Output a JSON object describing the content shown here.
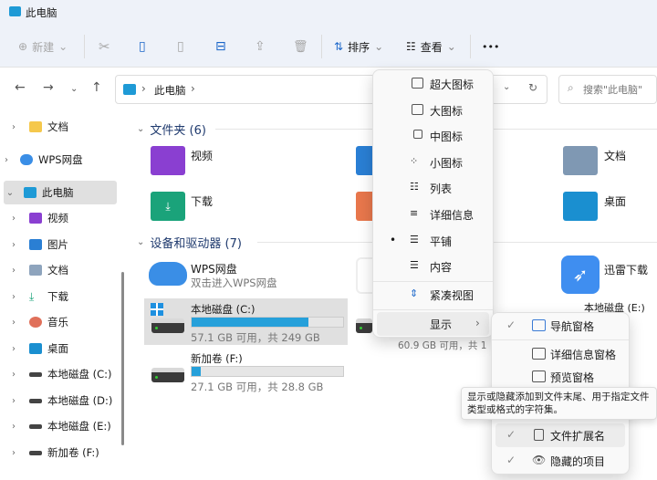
{
  "window": {
    "title": "此电脑"
  },
  "toolbar": {
    "new": "新建",
    "sort": "排序",
    "view": "查看",
    "more": "•••"
  },
  "address": {
    "path": "此电脑",
    "search_placeholder": "搜索\"此电脑\""
  },
  "sidebar": [
    {
      "label": "文档"
    },
    {
      "label": "WPS网盘"
    },
    {
      "label": "此电脑"
    },
    {
      "label": "视频"
    },
    {
      "label": "图片"
    },
    {
      "label": "文档"
    },
    {
      "label": "下载"
    },
    {
      "label": "音乐"
    },
    {
      "label": "桌面"
    },
    {
      "label": "本地磁盘 (C:)"
    },
    {
      "label": "本地磁盘 (D:)"
    },
    {
      "label": "本地磁盘 (E:)"
    },
    {
      "label": "新加卷 (F:)"
    }
  ],
  "folders": {
    "header": "文件夹 (6)",
    "items": [
      {
        "name": "视频"
      },
      {
        "name": "文档"
      },
      {
        "name": "下载"
      },
      {
        "name": "桌面"
      }
    ]
  },
  "devices": {
    "header": "设备和驱动器 (7)",
    "wps": {
      "name": "WPS网盘",
      "sub": "双击进入WPS网盘"
    },
    "xunlei": {
      "name": "迅雷下载"
    },
    "drives": [
      {
        "name": "本地磁盘 (C:)",
        "info": "57.1 GB 可用，共 249 GB",
        "used_fraction": 0.77
      },
      {
        "name": "新加卷 (F:)",
        "info": "27.1 GB 可用，共 28.8 GB",
        "used_fraction": 0.06
      },
      {
        "name": "本地磁盘 (E:)"
      },
      {
        "info": "60.9 GB 可用，共 1"
      }
    ]
  },
  "view_menu": {
    "items": [
      "超大图标",
      "大图标",
      "中图标",
      "小图标",
      "列表",
      "详细信息",
      "平铺",
      "内容"
    ],
    "selected": "平铺",
    "compact": "紧凑视图",
    "show": "显示"
  },
  "show_menu": {
    "items": [
      {
        "label": "导航窗格",
        "checked": true
      },
      {
        "label": "详细信息窗格",
        "checked": false
      },
      {
        "label": "预览窗格",
        "checked": false
      },
      {
        "label": "文件扩展名",
        "checked": true
      },
      {
        "label": "隐藏的项目",
        "checked": true
      }
    ]
  },
  "tooltip": "显示或隐藏添加到文件末尾、用于指定文件类型或格式的字符集。"
}
